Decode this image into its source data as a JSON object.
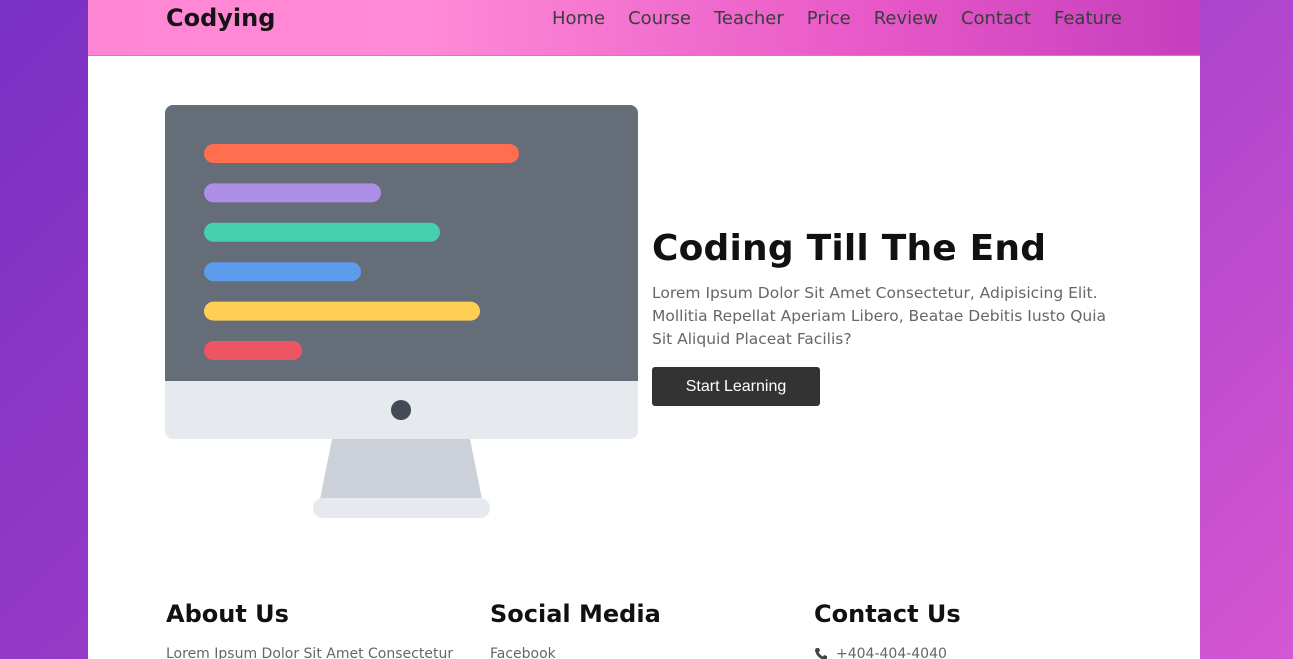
{
  "brand": {
    "name": "Codying"
  },
  "nav": {
    "items": [
      "Home",
      "Course",
      "Teacher",
      "Price",
      "Review",
      "Contact",
      "Feature"
    ]
  },
  "hero": {
    "title": "Coding Till The End",
    "description": "Lorem Ipsum Dolor Sit Amet Consectetur, Adipisicing Elit. Mollitia Repellat Aperiam Libero, Beatae Debitis Iusto Quia Sit Aliquid Placeat Facilis?",
    "button_label": "Start Learning"
  },
  "footer": {
    "about": {
      "heading": "About Us",
      "text": "Lorem Ipsum Dolor Sit Amet Consectetur"
    },
    "social": {
      "heading": "Social Media",
      "first_link": "Facebook"
    },
    "contact": {
      "heading": "Contact Us",
      "phone": "+404-404-4040"
    }
  },
  "colors": {
    "code_line_colors": [
      "#ff6f4f",
      "#ad8fe8",
      "#48cfad",
      "#5d9cec",
      "#ffce54",
      "#ed5565"
    ]
  },
  "icons": {
    "illustration": "desktop-monitor-icon",
    "phone": "phone-icon"
  }
}
